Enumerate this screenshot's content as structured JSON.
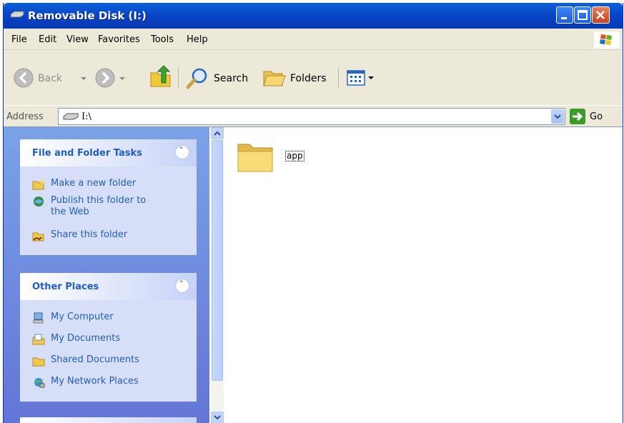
{
  "window": {
    "title": "Removable Disk (I:)"
  },
  "menu": [
    "File",
    "Edit",
    "View",
    "Favorites",
    "Tools",
    "Help"
  ],
  "toolbar": {
    "back_label": "Back",
    "search_label": "Search",
    "folders_label": "Folders"
  },
  "address": {
    "label": "Address",
    "value": "I:\\",
    "go_label": "Go"
  },
  "left_pane": {
    "file_tasks": {
      "title": "File and Folder Tasks",
      "items": [
        {
          "label": "Make a new folder",
          "icon": "new-folder-icon"
        },
        {
          "label_line1": "Publish this folder to",
          "label_line2": "the Web",
          "icon": "publish-web-icon"
        },
        {
          "label": "Share this folder",
          "icon": "share-folder-icon"
        }
      ]
    },
    "other_places": {
      "title": "Other Places",
      "items": [
        {
          "label": "My Computer",
          "icon": "my-computer-icon"
        },
        {
          "label": "My Documents",
          "icon": "my-documents-icon"
        },
        {
          "label": "Shared Documents",
          "icon": "shared-documents-icon"
        },
        {
          "label": "My Network Places",
          "icon": "network-places-icon"
        }
      ]
    }
  },
  "files": [
    {
      "name": "app",
      "type": "folder"
    }
  ]
}
